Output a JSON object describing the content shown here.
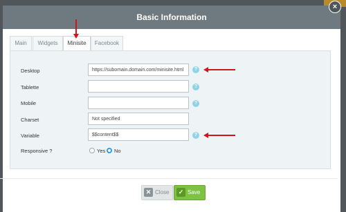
{
  "modal": {
    "title": "Basic Information",
    "close_symbol": "×"
  },
  "tabs": [
    {
      "label": "Main"
    },
    {
      "label": "Widgets"
    },
    {
      "label": "Minisite"
    },
    {
      "label": "Facebook"
    }
  ],
  "active_tab": "Minisite",
  "form": {
    "desktop": {
      "label": "Desktop",
      "value": "https://subomain.domain.com/minisite.html"
    },
    "tablette": {
      "label": "Tablette",
      "value": ""
    },
    "mobile": {
      "label": "Mobile",
      "value": ""
    },
    "charset": {
      "label": "Charset",
      "value": "Not specified"
    },
    "variable": {
      "label": "Variable",
      "value": "$$content$$"
    },
    "responsive": {
      "label": "Responsive ?",
      "yes_label": "Yes",
      "no_label": "No",
      "selected": "No"
    },
    "help_symbol": "?"
  },
  "buttons": {
    "close_label": "Close",
    "save_label": "Save"
  },
  "colors": {
    "header": "#6e7a7f",
    "accent_save": "#7dc242",
    "arrow": "#d2141a",
    "help": "#8fd3e6"
  }
}
